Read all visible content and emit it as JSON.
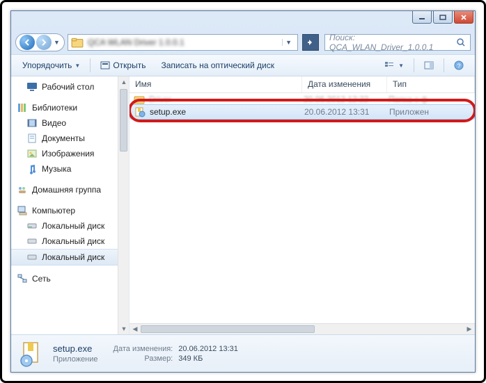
{
  "window": {
    "address_hint": "QCA WLAN Driver 1.0.0.1"
  },
  "nav": {
    "search_placeholder": "Поиск: QCA_WLAN_Driver_1.0.0.1"
  },
  "toolbar": {
    "organize": "Упорядочить",
    "open": "Открыть",
    "burn": "Записать на оптический диск"
  },
  "sidebar": {
    "desktop": "Рабочий стол",
    "libraries": "Библиотеки",
    "video": "Видео",
    "documents": "Документы",
    "pictures": "Изображения",
    "music": "Музыка",
    "homegroup": "Домашняя группа",
    "computer": "Компьютер",
    "localdisk1": "Локальный диск",
    "localdisk2": "Локальный диск",
    "localdisk3": "Локальный диск",
    "network": "Сеть"
  },
  "columns": {
    "name": "Имя",
    "date": "Дата изменения",
    "type": "Тип"
  },
  "files": {
    "partial": {
      "name": "Driver",
      "date": "20.06.2012 12:22",
      "type": "Папка с ф"
    },
    "selected": {
      "name": "setup.exe",
      "date": "20.06.2012 13:31",
      "type": "Приложен"
    }
  },
  "details": {
    "name": "setup.exe",
    "type": "Приложение",
    "date_label": "Дата изменения:",
    "date_value": "20.06.2012 13:31",
    "size_label": "Размер:",
    "size_value": "349 КБ"
  }
}
